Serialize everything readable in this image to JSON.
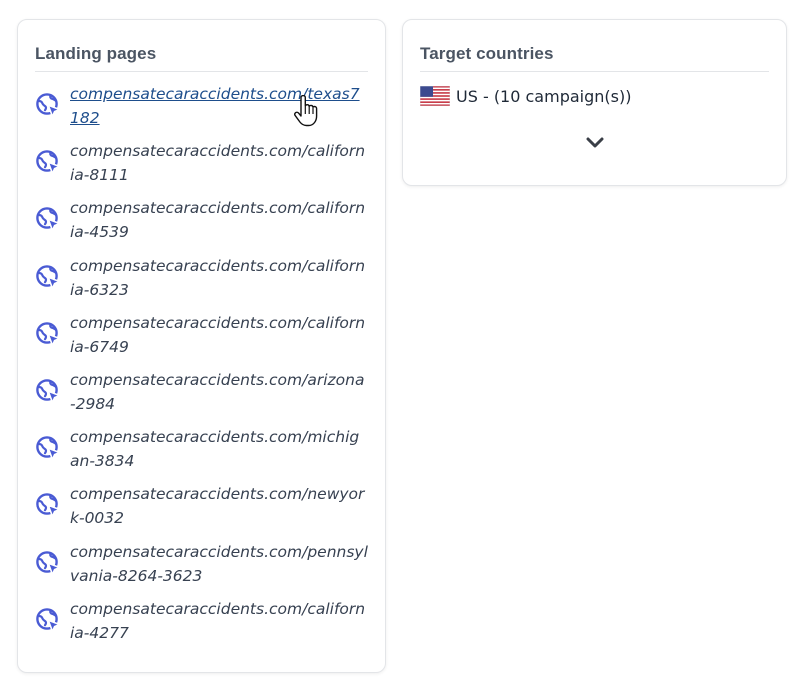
{
  "landing_pages": {
    "title": "Landing pages",
    "items": [
      {
        "url": "compensatecaraccidents.com/texas7182",
        "active": true
      },
      {
        "url": "compensatecaraccidents.com/california-8111",
        "active": false
      },
      {
        "url": "compensatecaraccidents.com/california-4539",
        "active": false
      },
      {
        "url": "compensatecaraccidents.com/california-6323",
        "active": false
      },
      {
        "url": "compensatecaraccidents.com/california-6749",
        "active": false
      },
      {
        "url": "compensatecaraccidents.com/arizona-2984",
        "active": false
      },
      {
        "url": "compensatecaraccidents.com/michigan-3834",
        "active": false
      },
      {
        "url": "compensatecaraccidents.com/newyork-0032",
        "active": false
      },
      {
        "url": "compensatecaraccidents.com/pennsylvania-8264-3623",
        "active": false
      },
      {
        "url": "compensatecaraccidents.com/california-4277",
        "active": false
      }
    ],
    "item_icon": "globe-pointer-icon"
  },
  "target_countries": {
    "title": "Target countries",
    "countries": [
      {
        "flag": "us-flag-icon",
        "label": "US - (10 campaign(s))"
      }
    ],
    "expand_icon": "chevron-down-icon"
  },
  "colors": {
    "icon_blue": "#4a5bd4",
    "link_active": "#1e4e8c",
    "title_gray": "#4b5563",
    "border": "#e3e5e8"
  }
}
